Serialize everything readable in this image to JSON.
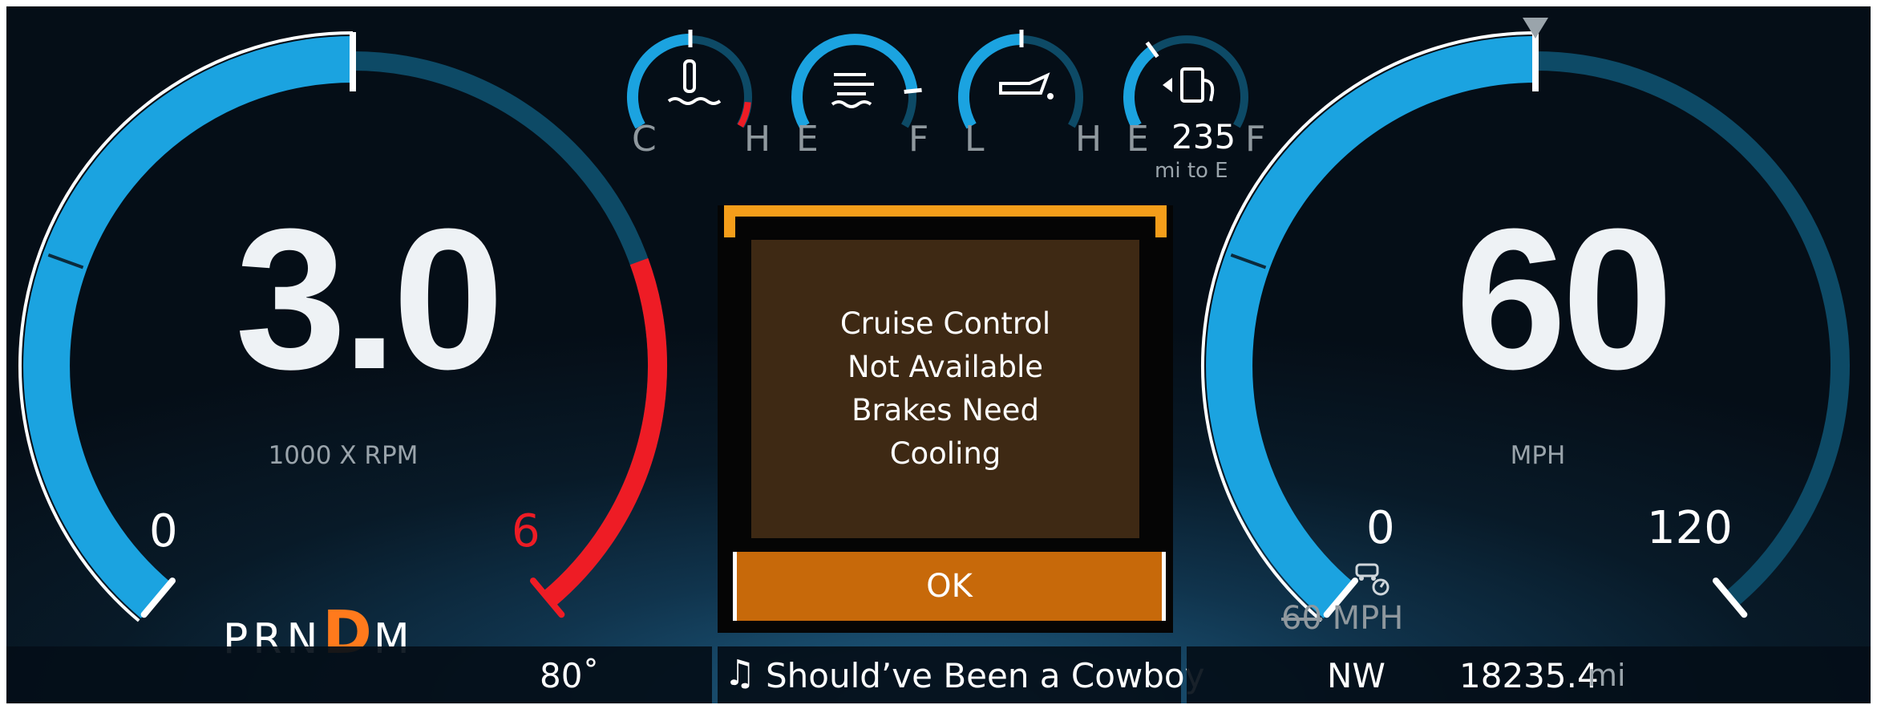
{
  "tachometer": {
    "value": "3.0",
    "unit": "1000 X RPM",
    "scale_min": "0",
    "scale_max": "6",
    "max_rpm_thousands": 6,
    "fill_rpm_thousands": 3.0,
    "redline_start_thousands": 4.5
  },
  "speedometer": {
    "value": "60",
    "unit": "MPH",
    "scale_min": "0",
    "scale_max": "120",
    "max_mph": 120,
    "fill_mph": 60,
    "cruise_set_speed": "60",
    "cruise_unit": "MPH"
  },
  "mini_gauges": {
    "coolant": {
      "icon": "coolant-temperature-icon",
      "min_label": "C",
      "max_label": "H",
      "level": 0.5
    },
    "def": {
      "icon": "diesel-exhaust-fluid-icon",
      "min_label": "E",
      "max_label": "F",
      "level": 0.85
    },
    "oil": {
      "icon": "oil-pressure-icon",
      "min_label": "L",
      "max_label": "H",
      "level": 0.5
    },
    "fuel": {
      "icon": "fuel-pump-icon",
      "min_label": "E",
      "max_label": "F",
      "level": 0.35,
      "range_value": "235",
      "range_unit": "mi to E"
    }
  },
  "gear": {
    "letters": [
      "P",
      "R",
      "N",
      "D",
      "M"
    ],
    "selected": "D"
  },
  "status_bar": {
    "outside_temp": "80˚",
    "now_playing": "Should’ve Been a Cowboy",
    "compass": "NW",
    "odometer_value": "18235.4",
    "odometer_unit": "mi"
  },
  "alert": {
    "message": "Cruise Control Not Available Brakes Need Cooling",
    "ok_label": "OK"
  },
  "colors": {
    "gauge_fill": "#1ba3e0",
    "gauge_track": "#0d4a66",
    "redline": "#ee1c25",
    "gear_active": "#ff7a1c",
    "alert_accent": "#f59e1a",
    "alert_body": "#3e2914",
    "ok_button": "#c7690a"
  }
}
